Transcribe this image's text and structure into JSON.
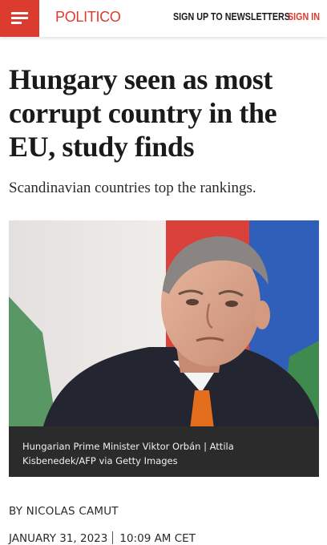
{
  "header": {
    "menu_icon": "hamburger-menu-icon",
    "logo": "POLITICO",
    "newsletter_label": "SIGN UP TO NEWSLETTERS",
    "signin_label": "SIGN IN",
    "brand_color": "#dc3b2f"
  },
  "article": {
    "headline_lines": [
      "Hungary seen as most",
      "corrupt country in the",
      "EU, study finds"
    ],
    "dek": "Scandinavian countries top the rankings.",
    "image": {
      "caption_lines": [
        "Hungarian Prime Minister Viktor Orbán | Attila",
        "Kisbenedek/AFP via Getty Images"
      ]
    },
    "byline": "BY NICOLAS CAMUT",
    "date": "JANUARY 31, 2023",
    "time": "10:09 AM CET"
  }
}
